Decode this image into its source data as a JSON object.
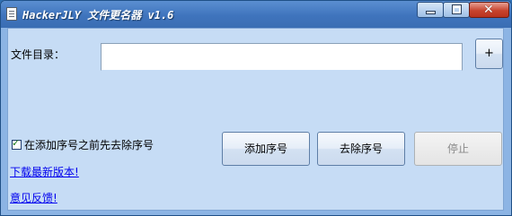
{
  "window": {
    "title": "HackerJLY 文件更名器 v1.6",
    "close_glyph": "✕",
    "icons": {
      "app": "document-icon",
      "min": "minimize-icon",
      "max": "maximize-icon",
      "close": "close-icon"
    }
  },
  "form": {
    "dir_label": "文件目录：",
    "dir_value": "",
    "add_dir_label": "+"
  },
  "options": {
    "checkbox_label": "在添加序号之前先去除序号",
    "checkbox_checked": true,
    "check_glyph": "✓"
  },
  "actions": {
    "add_label": "添加序号",
    "remove_label": "去除序号",
    "stop_label": "停止",
    "stop_enabled": false
  },
  "links": {
    "download": "下载最新版本!",
    "feedback": "意见反馈!"
  },
  "colors": {
    "title_bar": "#3f74bd",
    "client_bg": "#c6dcf5",
    "link": "#0000ee",
    "close_button": "#c7442e"
  }
}
